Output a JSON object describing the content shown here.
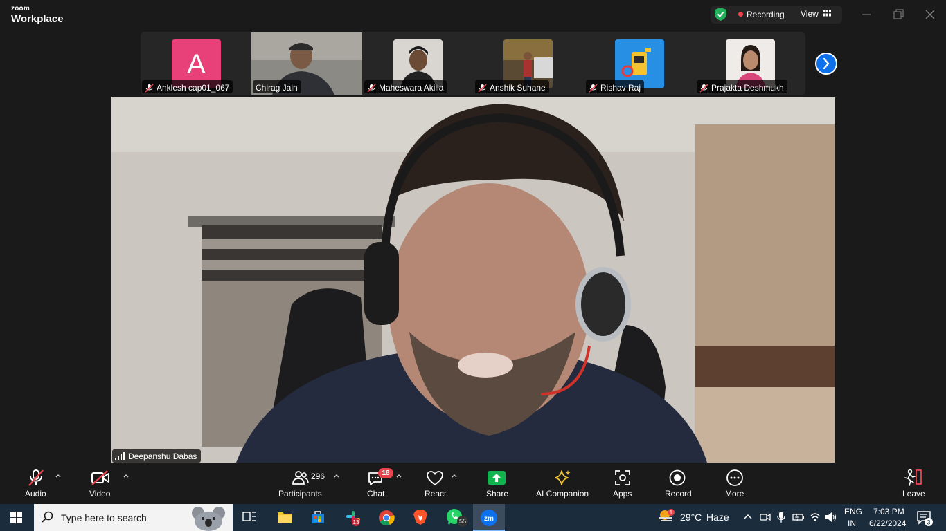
{
  "window": {
    "brand_small": "zoom",
    "brand_large": "Workplace",
    "recording_label": "Recording",
    "view_label": "View"
  },
  "gallery": {
    "participants": [
      {
        "name": "Anklesh  cap01_067",
        "muted": true,
        "avatar_letter": "A",
        "avatar_color": "#e8417a"
      },
      {
        "name": "Chirag Jain",
        "muted": false
      },
      {
        "name": "Maheswara Akilla",
        "muted": true
      },
      {
        "name": "Anshik Suhane",
        "muted": true
      },
      {
        "name": "Rishav Raj",
        "muted": true
      },
      {
        "name": "Prajakta Deshmukh",
        "muted": true
      }
    ],
    "next_icon": "chevron-right-icon"
  },
  "main": {
    "speaker_name": "Deepanshu Dabas"
  },
  "toolbar": {
    "audio": "Audio",
    "video": "Video",
    "participants": "Participants",
    "participants_count": "296",
    "chat": "Chat",
    "chat_badge": "18",
    "react": "React",
    "share": "Share",
    "ai_companion": "AI Companion",
    "apps": "Apps",
    "record": "Record",
    "more": "More",
    "leave": "Leave"
  },
  "taskbar": {
    "search_placeholder": "Type here to search",
    "slack_badge": "13",
    "whatsapp_badge": "55",
    "zoom_label": "zm",
    "weather_badge": "1",
    "temperature": "29°C",
    "weather": "Haze",
    "lang_1": "ENG",
    "lang_2": "IN",
    "time": "7:03 PM",
    "date": "6/22/2024",
    "notification_count": "3"
  },
  "colors": {
    "accent_blue": "#0e71eb",
    "recording_red": "#e8444d",
    "share_green": "#12b44e",
    "taskbar": "#1b2c3d"
  }
}
